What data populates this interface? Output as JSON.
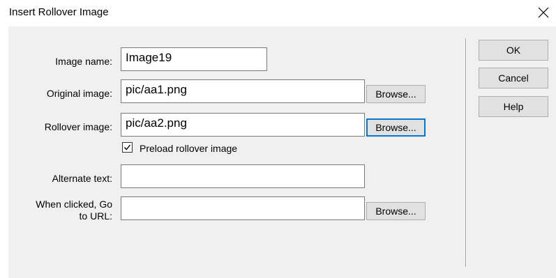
{
  "dialog": {
    "title": "Insert Rollover Image",
    "close_icon": "close-icon"
  },
  "form": {
    "image_name": {
      "label": "Image name:",
      "value": "Image19"
    },
    "original_image": {
      "label": "Original image:",
      "value": "pic/aa1.png",
      "browse": "Browse..."
    },
    "rollover_image": {
      "label": "Rollover image:",
      "value": "pic/aa2.png",
      "browse": "Browse..."
    },
    "preload": {
      "label": "Preload rollover image",
      "checked": true
    },
    "alternate_text": {
      "label": "Alternate text:",
      "value": ""
    },
    "go_to_url": {
      "label_line1": "When clicked, Go",
      "label_line2": "to URL:",
      "value": "",
      "browse": "Browse..."
    }
  },
  "buttons": {
    "ok": "OK",
    "cancel": "Cancel",
    "help": "Help"
  },
  "colors": {
    "dialog_bg": "#f0f0f0",
    "focus_border": "#0078d7"
  }
}
